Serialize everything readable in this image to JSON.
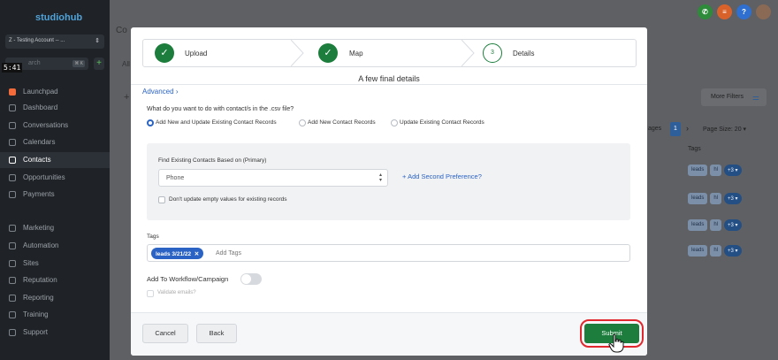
{
  "sidebar": {
    "logo": "studiohub",
    "account": "Z - Testing Account -- ...",
    "search_placeholder": "arch",
    "search_shortcut": "⌘ K",
    "time": "5:41",
    "items": [
      {
        "label": "Launchpad",
        "icon": "rocket-icon"
      },
      {
        "label": "Dashboard",
        "icon": "dashboard-icon"
      },
      {
        "label": "Conversations",
        "icon": "chat-icon"
      },
      {
        "label": "Calendars",
        "icon": "calendar-icon"
      },
      {
        "label": "Contacts",
        "icon": "contacts-icon",
        "active": true
      },
      {
        "label": "Opportunities",
        "icon": "funnel-icon"
      },
      {
        "label": "Payments",
        "icon": "payments-icon"
      },
      {
        "label": "Marketing",
        "icon": "send-icon"
      },
      {
        "label": "Automation",
        "icon": "automation-icon"
      },
      {
        "label": "Sites",
        "icon": "globe-icon"
      },
      {
        "label": "Reputation",
        "icon": "star-icon"
      },
      {
        "label": "Reporting",
        "icon": "chart-icon"
      },
      {
        "label": "Training",
        "icon": "book-icon"
      },
      {
        "label": "Support",
        "icon": "help-icon"
      }
    ]
  },
  "topbar": {
    "help": "?"
  },
  "background": {
    "title": "Co",
    "tab_all": "All",
    "more_filters": "More Filters",
    "pages_label": "ages",
    "page_number": "1",
    "page_size": "Page Size: 20",
    "tags_header": "Tags",
    "chip_leads": "leads",
    "chip_hl": "hl",
    "chip_more": "+3"
  },
  "modal": {
    "steps": [
      {
        "label": "Upload",
        "state": "done"
      },
      {
        "label": "Map",
        "state": "done"
      },
      {
        "label": "Details",
        "number": "3",
        "state": "current"
      }
    ],
    "heading": "A few final details",
    "advanced": "Advanced",
    "question": "What do you want to do with contact/s in the .csv file?",
    "options": [
      {
        "label": "Add New and Update Existing Contact Records",
        "selected": true
      },
      {
        "label": "Add New Contact Records",
        "selected": false
      },
      {
        "label": "Update Existing Contact Records",
        "selected": false
      }
    ],
    "find_label": "Find Existing Contacts Based on (Primary)",
    "find_value": "Phone",
    "add_second": "Add Second Preference?",
    "dont_update": "Don't update empty values for existing records",
    "tags_label": "Tags",
    "tag_chip": "leads 3/21/22",
    "tags_placeholder": "Add Tags",
    "workflow_label": "Add To Workflow/Campaign",
    "validate_label": "Validate emails?",
    "cancel": "Cancel",
    "back": "Back",
    "submit": "Submit"
  },
  "colors": {
    "primary_green": "#1c7d3c",
    "link_blue": "#2b63c4",
    "highlight_red": "#e0282e"
  }
}
